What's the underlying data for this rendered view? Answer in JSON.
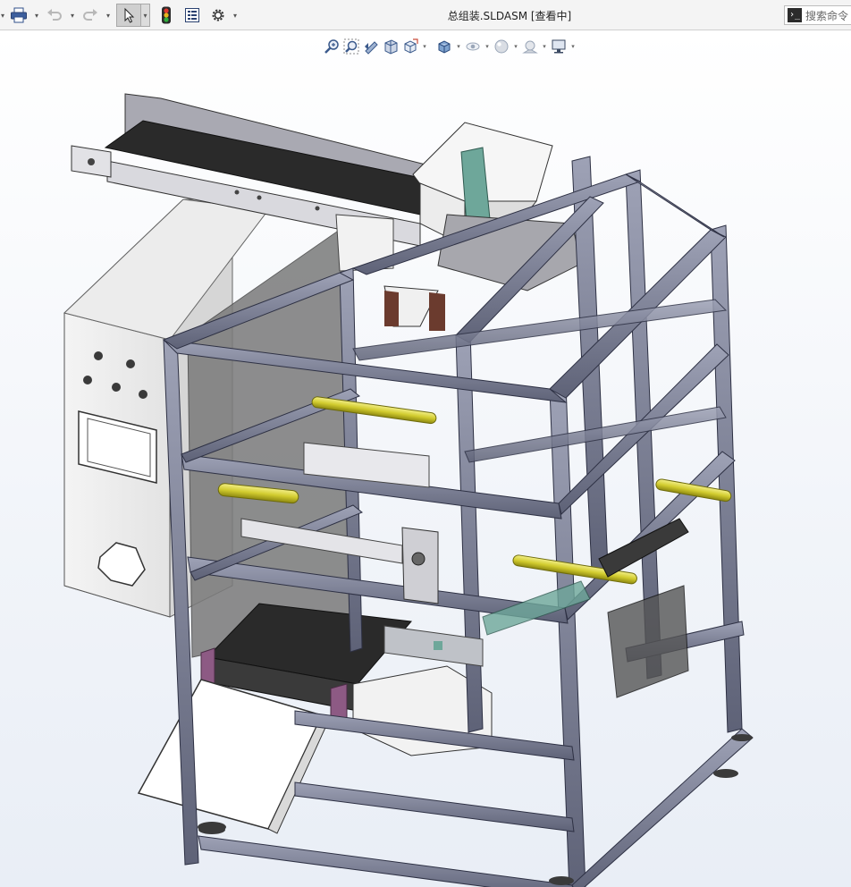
{
  "window": {
    "document_title": "总组装.SLDASM [查看中]"
  },
  "search": {
    "placeholder": "搜索命令",
    "prompt_glyph": "›_"
  },
  "toolbar": {
    "icons": [
      "print-icon",
      "undo-icon",
      "redo-icon",
      "select-cursor-icon",
      "traffic-light-icon",
      "file-properties-icon",
      "options-gear-icon"
    ],
    "dropdown_glyph": "▾"
  },
  "view_toolbar": {
    "icons": [
      "zoom-to-fit-icon",
      "zoom-to-area-icon",
      "previous-view-icon",
      "section-view-icon",
      "view-orientation-icon",
      "display-style-icon",
      "hide-show-items-icon",
      "edit-appearance-icon",
      "apply-scene-icon",
      "view-settings-icon"
    ],
    "dropdown_glyph": "▾"
  },
  "colors": {
    "frame_profile": "#7d8196",
    "frame_dark": "#3c3f52",
    "panel": "#f2f2f2",
    "belt": "#2a2a2a",
    "cylinder": "#d6d23c",
    "accent_green": "#6ea79a",
    "accent_magenta": "#8d5a84"
  }
}
